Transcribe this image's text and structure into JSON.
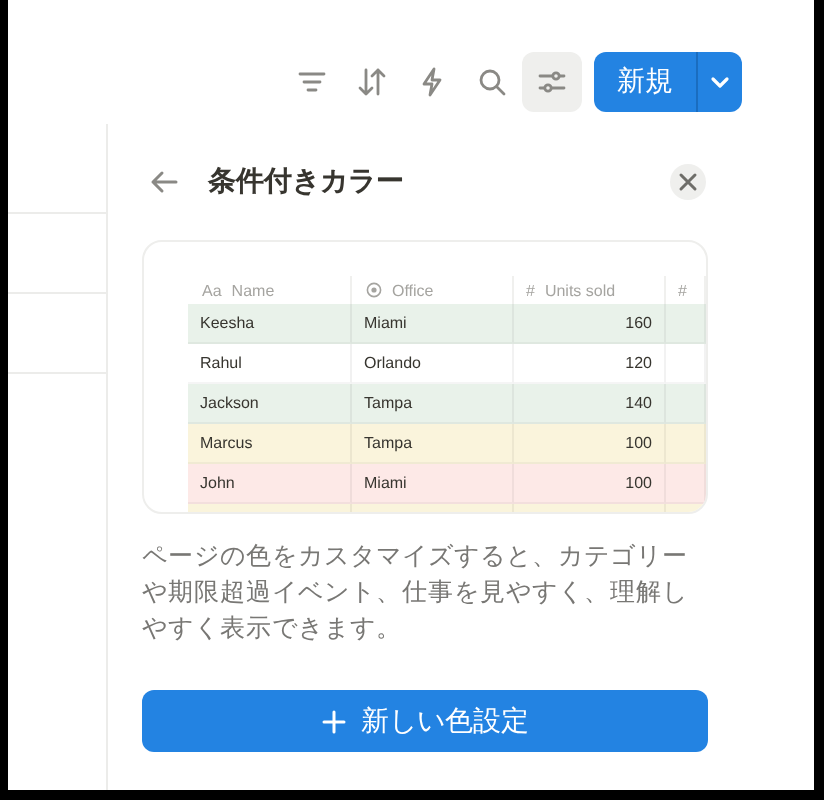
{
  "toolbar": [
    {
      "kind": "filter",
      "selected": false
    },
    {
      "kind": "sort",
      "selected": false
    },
    {
      "kind": "automation",
      "selected": false
    },
    {
      "kind": "search",
      "selected": false
    },
    {
      "kind": "settings",
      "selected": true
    }
  ],
  "new_button": {
    "label": "新規"
  },
  "panel": {
    "title": "条件付きカラー",
    "preview": {
      "columns": [
        {
          "kind": "text",
          "icon": "Aa",
          "label": "Name"
        },
        {
          "kind": "select",
          "label": "Office"
        },
        {
          "kind": "number",
          "icon": "#",
          "label": "Units sold"
        },
        {
          "kind": "number",
          "icon": "#"
        }
      ],
      "rows": [
        {
          "color": "#e9f2ea",
          "cells": [
            "Keesha",
            "Miami",
            "160"
          ]
        },
        {
          "color": "#ffffff",
          "cells": [
            "Rahul",
            "Orlando",
            "120"
          ]
        },
        {
          "color": "#e9f2ea",
          "cells": [
            "Jackson",
            "Tampa",
            "140"
          ]
        },
        {
          "color": "#faf4dc",
          "cells": [
            "Marcus",
            "Tampa",
            "100"
          ]
        },
        {
          "color": "#fde9e7",
          "cells": [
            "John",
            "Miami",
            "100"
          ]
        },
        {
          "color": "#faf4dc",
          "cells": []
        }
      ]
    },
    "description": "ページの色をカスタマイズすると、カテゴリーや期限超過イベント、仕事を見やすく、理解しやすく表示できます。",
    "add_button": "新しい色設定"
  }
}
